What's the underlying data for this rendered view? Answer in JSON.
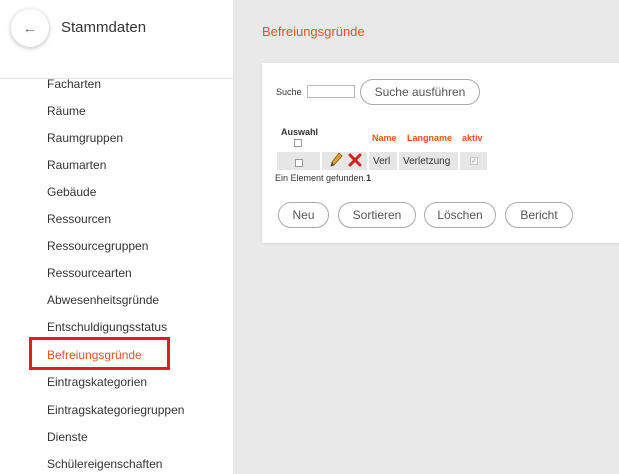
{
  "sidebar": {
    "back_icon": "←",
    "title": "Stammdaten",
    "items": [
      "Facharten",
      "Räume",
      "Raumgruppen",
      "Raumarten",
      "Gebäude",
      "Ressourcen",
      "Ressourcegruppen",
      "Ressourcearten",
      "Abwesenheitsgründe",
      "Entschuldigungsstatus",
      "Befreiungsgründe",
      "Eintragskategorien",
      "Eintragskategoriegruppen",
      "Dienste",
      "Schülereigenschaften"
    ],
    "active_index": 10
  },
  "page": {
    "title": "Befreiungsgründe"
  },
  "search": {
    "label": "Suche",
    "value": "",
    "button": "Suche ausführen"
  },
  "table": {
    "headers": {
      "select": "Auswahl",
      "name": "Name",
      "longname": "Langname",
      "active": "aktiv"
    },
    "rows": [
      {
        "name": "Verl",
        "longname": "Verletzung",
        "active": true
      }
    ]
  },
  "status": {
    "found_text": "Ein Element gefunden.",
    "count": "1"
  },
  "actions": {
    "new": "Neu",
    "sort": "Sortieren",
    "delete": "Löschen",
    "report": "Bericht"
  },
  "colors": {
    "accent": "#ea5129",
    "highlight_border": "#e01c24",
    "background": "#e9e9e9"
  }
}
